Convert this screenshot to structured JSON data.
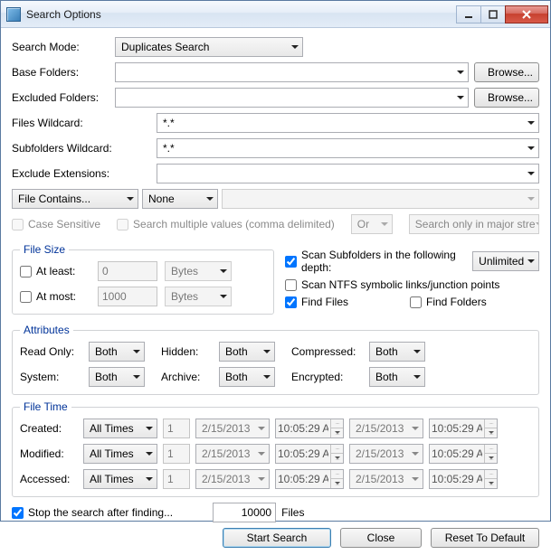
{
  "title": "Search Options",
  "labels": {
    "searchMode": "Search Mode:",
    "baseFolders": "Base Folders:",
    "excludedFolders": "Excluded Folders:",
    "filesWildcard": "Files Wildcard:",
    "subfoldersWildcard": "Subfolders Wildcard:",
    "excludeExt": "Exclude Extensions:",
    "browse": "Browse...",
    "caseSensitive": "Case Sensitive",
    "multiValues": "Search multiple values (comma delimited)",
    "or": "Or",
    "majorStreams": "Search only in major stre",
    "fileSize": "File Size",
    "atLeast": "At least:",
    "atMost": "At most:",
    "bytes": "Bytes",
    "scanSub": "Scan Subfolders in the following depth:",
    "unlimited": "Unlimited",
    "scanNtfs": "Scan NTFS symbolic links/junction points",
    "findFiles": "Find Files",
    "findFolders": "Find Folders",
    "attributes": "Attributes",
    "readOnly": "Read Only:",
    "hidden": "Hidden:",
    "system": "System:",
    "archive": "Archive:",
    "compressed": "Compressed:",
    "encrypted": "Encrypted:",
    "both": "Both",
    "fileTime": "File Time",
    "created": "Created:",
    "modified": "Modified:",
    "accessed": "Accessed:",
    "allTimes": "All Times",
    "stopAfter": "Stop the search after finding...",
    "files": "Files",
    "startSearch": "Start Search",
    "close": "Close",
    "reset": "Reset To Default"
  },
  "values": {
    "searchMode": "Duplicates Search",
    "filesWildcard": "*.*",
    "subfoldersWildcard": "*.*",
    "fileContains": "File Contains...",
    "contentMatch": "None",
    "atLeast": "0",
    "atMost": "1000",
    "countNum": "1",
    "date": "2/15/2013",
    "time": "10:05:29 A",
    "stopCount": "10000"
  },
  "checks": {
    "scanSub": true,
    "scanNtfs": false,
    "findFiles": true,
    "findFolders": false,
    "stopAfter": true
  }
}
